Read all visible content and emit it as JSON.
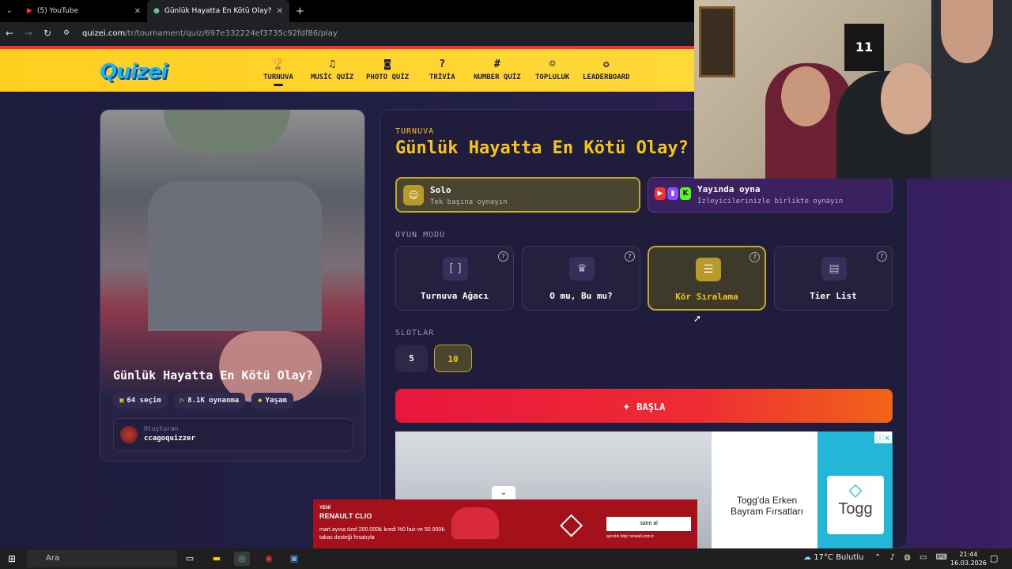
{
  "browser": {
    "tabs": [
      {
        "label": "(5) YouTube"
      },
      {
        "label": "Günlük Hayatta En Kötü Olay?"
      }
    ],
    "url_domain": "quizei.com",
    "url_path": "/tr/tournament/quiz/697e332224ef3735c92fdf86/play"
  },
  "site": {
    "logo": "Quizei",
    "nav": [
      {
        "label": "TURNUVA",
        "icon": "trophy-icon",
        "glyph": "🏆"
      },
      {
        "label": "MUSİC QUİZ",
        "icon": "music-icon",
        "glyph": "♫"
      },
      {
        "label": "PHOTO QUİZ",
        "icon": "camera-icon",
        "glyph": "◙"
      },
      {
        "label": "TRİVİA",
        "icon": "question-icon",
        "glyph": "?"
      },
      {
        "label": "NUMBER QUİZ",
        "icon": "hash-icon",
        "glyph": "#"
      },
      {
        "label": "TOPLULUK",
        "icon": "users-icon",
        "glyph": "☺"
      },
      {
        "label": "LEADERBOARD",
        "icon": "medal-icon",
        "glyph": "✪"
      }
    ]
  },
  "card": {
    "title": "Günlük Hayatta En Kötü Olay?",
    "stats": [
      {
        "label": "64 seçim",
        "icon": "image-icon",
        "glyph": "▣"
      },
      {
        "label": "8.1K oynanma",
        "icon": "play-icon",
        "glyph": "▷"
      },
      {
        "label": "Yaşam",
        "icon": "category-icon",
        "glyph": "◆"
      }
    ],
    "creator_label": "Oluşturan",
    "creator_name": "ccagoquizzer"
  },
  "panel": {
    "kicker": "TURNUVA",
    "title": "Günlük Hayatta En Kötü Olay?",
    "play_options": [
      {
        "title": "Solo",
        "subtitle": "Tek başına oynayın"
      },
      {
        "title": "Yayında oyna",
        "subtitle": "İzleyicilerinizle birlikte oynayın"
      }
    ],
    "mode_label": "OYUN MODU",
    "modes": [
      {
        "label": "Turnuva Ağacı",
        "icon": "bracket-icon",
        "glyph": "[ ]"
      },
      {
        "label": "O mu, Bu mu?",
        "icon": "crown-icon",
        "glyph": "♛"
      },
      {
        "label": "Kör Sıralama",
        "icon": "ordered-list-icon",
        "glyph": "☰"
      },
      {
        "label": "Tier List",
        "icon": "tier-list-icon",
        "glyph": "▤"
      }
    ],
    "selected_mode": "Kör Sıralama",
    "slots_label": "SLOTLAR",
    "slots": [
      "5",
      "10"
    ],
    "selected_slot": "10",
    "start_label": "BAŞLA"
  },
  "ads": {
    "togg_text": "Togg'da Erken Bayram Fırsatları",
    "togg_brand": "Togg",
    "renault_tag": "YENİ",
    "renault_model": "RENAULT CLIO",
    "renault_offer": "mart ayına özel 200.000₺ kredi %0 faiz ve 50.000₺ takas desteği fırsatıyla",
    "renault_cta": "satın al",
    "renault_fine": "ayrıntılı bilgi: renault.com.tr"
  },
  "webcam": {
    "jersey_number": "11"
  },
  "taskbar": {
    "search_placeholder": "Ara",
    "weather": "17°C Bulutlu",
    "time": "21:44",
    "date": "16.03.2026"
  },
  "colors": {
    "accent_yellow": "#f5c518",
    "header_yellow": "#ffd93a",
    "start_red": "#e8163d",
    "start_orange": "#f06418",
    "bg_navy": "#1e1c3d"
  }
}
